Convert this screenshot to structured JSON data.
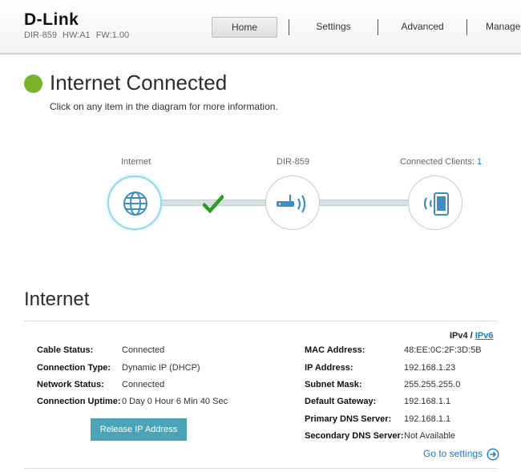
{
  "header": {
    "logo": "D-Link",
    "model": "DIR-859   HW:A1   FW:1.00",
    "nav": [
      {
        "label": "Home",
        "active": true
      },
      {
        "label": "Settings",
        "active": false
      },
      {
        "label": "Advanced",
        "active": false
      },
      {
        "label": "Management",
        "active": false
      }
    ]
  },
  "status": {
    "title": "Internet Connected",
    "subtitle": "Click on any item in the diagram for more information.",
    "color": "#7ab32a"
  },
  "diagram": {
    "internet_label": "Internet",
    "router_label": "DIR-859",
    "clients_label": "Connected Clients: ",
    "clients_count": "1",
    "icons": [
      "globe-icon",
      "router-icon",
      "device-icon",
      "checkmark-icon"
    ]
  },
  "internet": {
    "title": "Internet",
    "ipv4": "IPv4",
    "sep": "/",
    "ipv6": "IPv6",
    "left": [
      {
        "label": "Cable Status:",
        "value": "Connected"
      },
      {
        "label": "Connection Type:",
        "value": "Dynamic IP (DHCP)"
      },
      {
        "label": "Network Status:",
        "value": "Connected"
      },
      {
        "label": "Connection Uptime:",
        "value": "0 Day 0 Hour 6 Min 40 Sec"
      }
    ],
    "right": [
      {
        "label": "MAC Address:",
        "value": "48:EE:0C:2F:3D:5B"
      },
      {
        "label": "IP Address:",
        "value": "192.168.1.23"
      },
      {
        "label": "Subnet Mask:",
        "value": "255.255.255.0"
      },
      {
        "label": "Default Gateway:",
        "value": "192.168.1.1"
      },
      {
        "label": "Primary DNS Server:",
        "value": "192.168.1.1"
      },
      {
        "label": "Secondary DNS Server:",
        "value": "Not Available"
      }
    ],
    "release_button": "Release IP Address",
    "goto_settings": "Go to settings"
  },
  "colors": {
    "accent": "#1b7cc1",
    "button": "#4aa3b6",
    "check": "#2a9c20"
  }
}
